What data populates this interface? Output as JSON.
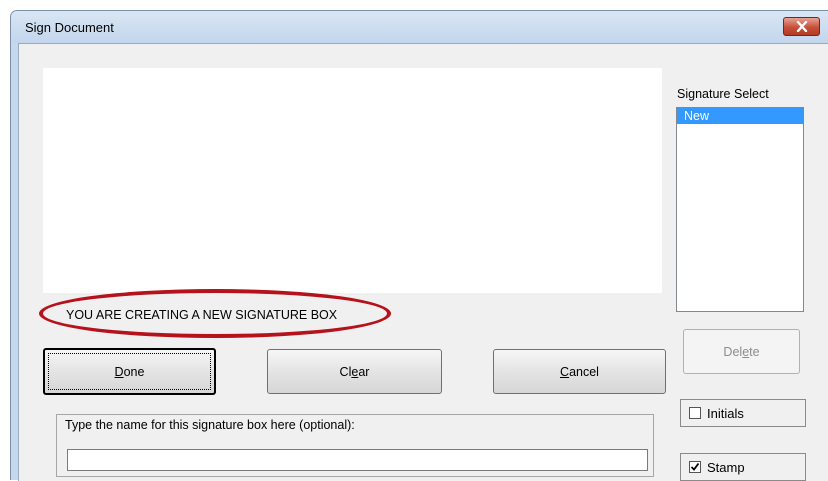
{
  "dialog": {
    "title": "Sign Document",
    "close_icon": "close-icon"
  },
  "status": {
    "message": "YOU ARE CREATING A NEW SIGNATURE BOX",
    "highlight_color": "#b5121b"
  },
  "signature_select": {
    "label": "Signature Select",
    "items": [
      "New"
    ],
    "selected": "New",
    "selected_color": "#3399ff"
  },
  "buttons": {
    "done": {
      "pre": "",
      "mnemonic": "D",
      "post": "one"
    },
    "clear": {
      "pre": "Cl",
      "mnemonic": "e",
      "post": "ar"
    },
    "cancel": {
      "pre": "",
      "mnemonic": "C",
      "post": "ancel"
    },
    "delete": {
      "pre": "Del",
      "mnemonic": "e",
      "post": "te"
    }
  },
  "options": {
    "initials": {
      "label": "Initials",
      "checked": false
    },
    "stamp": {
      "label": "Stamp",
      "checked": true
    }
  },
  "name_field": {
    "label": "Type the name for this signature box here (optional):",
    "value": ""
  }
}
